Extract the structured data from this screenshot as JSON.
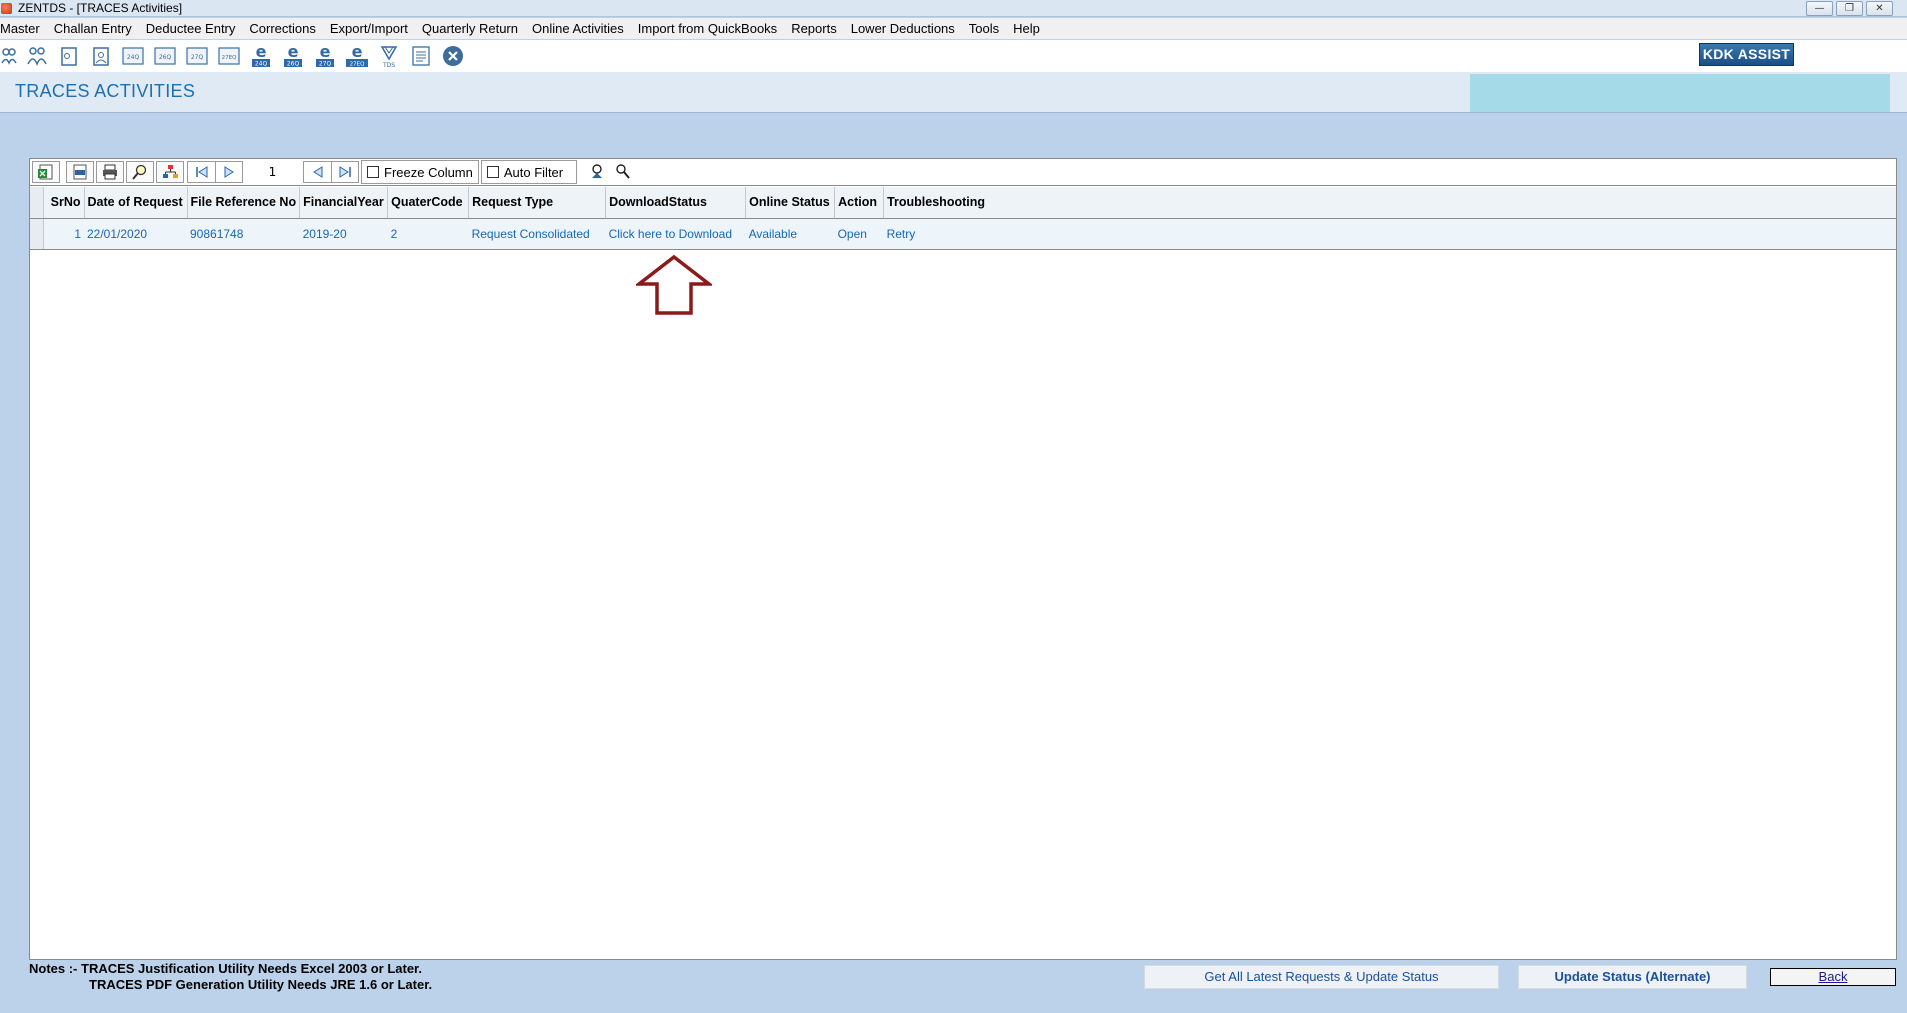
{
  "window": {
    "title": "ZENTDS - [TRACES Activities]",
    "controls": [
      "minimize",
      "restore",
      "close"
    ]
  },
  "menu": [
    "Master",
    "Challan Entry",
    "Deductee Entry",
    "Corrections",
    "Export/Import",
    "Quarterly Return",
    "Online Activities",
    "Import from QuickBooks",
    "Reports",
    "Lower Deductions",
    "Tools",
    "Help"
  ],
  "toolbar": {
    "icons": [
      {
        "name": "deductor-icon"
      },
      {
        "name": "deductors-group-icon"
      },
      {
        "name": "form-icon"
      },
      {
        "name": "form-alt-icon"
      },
      {
        "name": "form-24q-icon",
        "label": "24Q"
      },
      {
        "name": "form-26q-icon",
        "label": "26Q"
      },
      {
        "name": "form-27q-icon",
        "label": "27Q"
      },
      {
        "name": "form-27eq-icon",
        "label": "27EQ"
      },
      {
        "name": "e-24q-icon",
        "label": "24Q"
      },
      {
        "name": "e-26q-icon",
        "label": "26Q"
      },
      {
        "name": "e-27q-icon",
        "label": "27Q"
      },
      {
        "name": "e-27eq-icon",
        "label": "27EQ"
      },
      {
        "name": "tds-icon",
        "label": "TDS"
      },
      {
        "name": "report-icon"
      },
      {
        "name": "close-circle-icon"
      }
    ],
    "kdk_assist": "KDK ASSIST"
  },
  "page": {
    "title": "TRACES ACTIVITIES"
  },
  "grid_toolbar": {
    "page_number": "1",
    "freeze_column": {
      "label": "Freeze Column",
      "checked": false
    },
    "auto_filter": {
      "label": "Auto Filter",
      "checked": false
    }
  },
  "table": {
    "columns": [
      "SrNo",
      "Date of Request",
      "File Reference No",
      "FinancialYear",
      "QuaterCode",
      "Request Type",
      "DownloadStatus",
      "Online Status",
      "Action",
      "Troubleshooting"
    ],
    "rows": [
      {
        "srno": "1",
        "date": "22/01/2020",
        "file_ref": "90861748",
        "fy": "2019-20",
        "quarter": "2",
        "request_type": "Request Consolidated",
        "download_status": "Click here to Download",
        "online_status": "Available",
        "action": "Open",
        "troubleshooting": "Retry"
      }
    ]
  },
  "footer": {
    "note1": "Notes :- TRACES Justification Utility Needs Excel 2003 or Later.",
    "note2": "TRACES PDF Generation Utility Needs JRE 1.6 or Later.",
    "buttons": {
      "get_latest": "Get All Latest Requests & Update Status",
      "update_alt": "Update Status (Alternate)",
      "back": "Back"
    }
  },
  "colors": {
    "background": "#bcd2ea",
    "title_blue": "#1f6fb0",
    "link_blue": "#1666b5",
    "arrow_red": "#8b1a1a",
    "kdk_blue": "#1b4f86"
  }
}
